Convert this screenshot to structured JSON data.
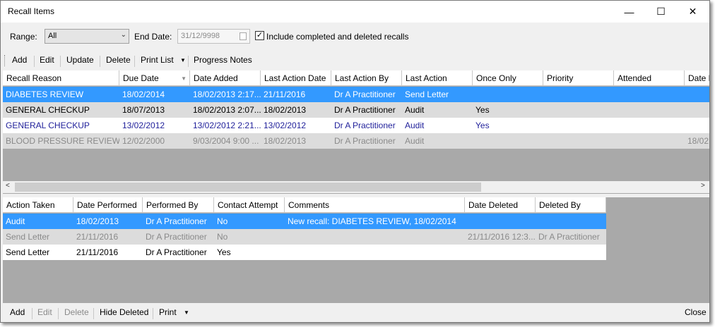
{
  "window": {
    "title": "Recall Items",
    "minimize": "—",
    "maximize": "☐",
    "close": "✕"
  },
  "filter": {
    "range_label": "Range:",
    "range_value": "All",
    "end_date_label": "End Date:",
    "end_date_value": "31/12/9998",
    "include_checked": true,
    "include_label": "Include completed and deleted recalls"
  },
  "top_toolbar": {
    "add": "Add",
    "edit": "Edit",
    "update": "Update",
    "delete": "Delete",
    "print_list": "Print List",
    "progress_notes": "Progress Notes"
  },
  "recalls": {
    "columns": [
      "Recall Reason",
      "Due Date",
      "Date Added",
      "Last Action Date",
      "Last Action By",
      "Last Action",
      "Once Only",
      "Priority",
      "Attended",
      "Date D"
    ],
    "rows": [
      {
        "style": "sel",
        "cells": [
          "DIABETES REVIEW",
          "18/02/2014",
          "18/02/2013 2:17...",
          "21/11/2016",
          "Dr A Practitioner",
          "Send Letter",
          "",
          "",
          "",
          ""
        ]
      },
      {
        "style": "gray",
        "cells": [
          "GENERAL CHECKUP",
          "18/07/2013",
          "18/02/2013 2:07...",
          "18/02/2013",
          "Dr A Practitioner",
          "Audit",
          "Yes",
          "",
          "",
          ""
        ]
      },
      {
        "style": "blue",
        "cells": [
          "GENERAL CHECKUP",
          "13/02/2012",
          "13/02/2012 2:21...",
          "13/02/2012",
          "Dr A Practitioner",
          "Audit",
          "Yes",
          "",
          "",
          ""
        ]
      },
      {
        "style": "deleted",
        "cells": [
          "BLOOD PRESSURE REVIEW",
          "12/02/2000",
          "9/03/2004 9:00 ...",
          "18/02/2013",
          "Dr A Practitioner",
          "Audit",
          "",
          "",
          "",
          "18/02"
        ]
      }
    ]
  },
  "actions": {
    "columns": [
      "Action Taken",
      "Date Performed",
      "Performed By",
      "Contact Attempt",
      "Comments",
      "Date Deleted",
      "Deleted By"
    ],
    "rows": [
      {
        "style": "sel",
        "cells": [
          "Audit",
          "18/02/2013",
          "Dr A Practitioner",
          "No",
          "New recall: DIABETES REVIEW, 18/02/2014",
          "",
          ""
        ]
      },
      {
        "style": "deleted",
        "cells": [
          "Send Letter",
          "21/11/2016",
          "Dr A Practitioner",
          "No",
          "",
          "21/11/2016 12:3...",
          "Dr A Practitioner"
        ]
      },
      {
        "style": "white",
        "cells": [
          "Send Letter",
          "21/11/2016",
          "Dr A Practitioner",
          "Yes",
          "",
          "",
          ""
        ]
      }
    ]
  },
  "bottom_toolbar": {
    "add": "Add",
    "edit": "Edit",
    "delete": "Delete",
    "hide_deleted": "Hide Deleted",
    "print": "Print",
    "close": "Close"
  }
}
